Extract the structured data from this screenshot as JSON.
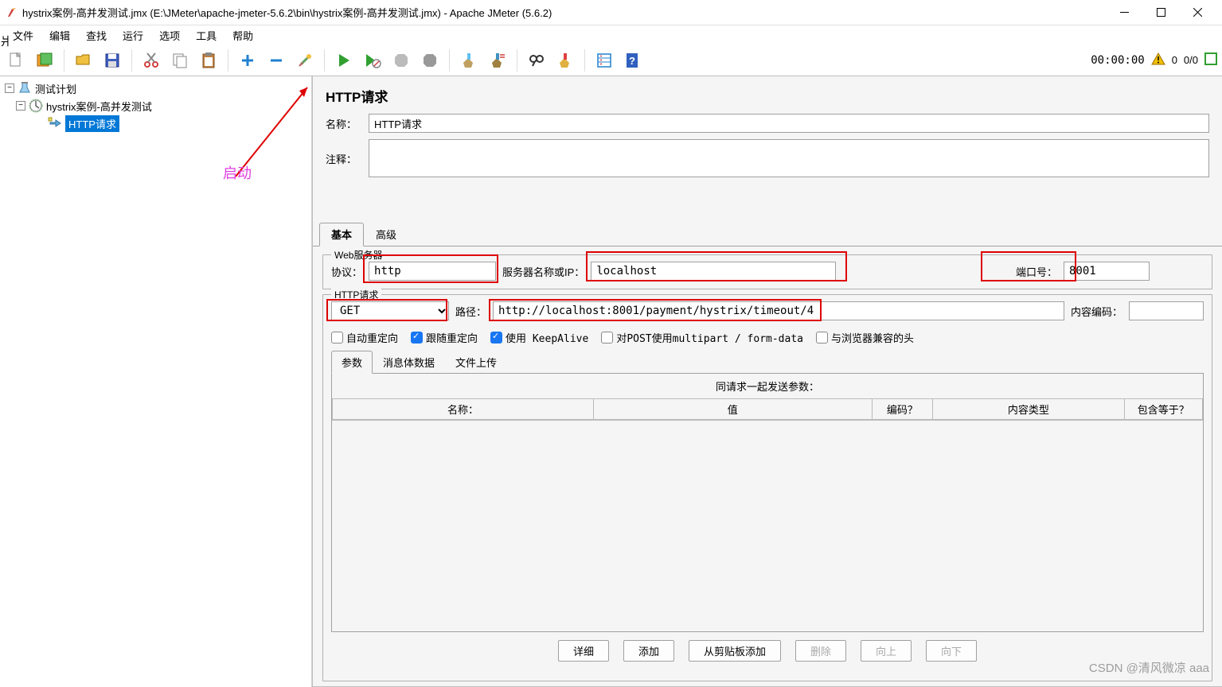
{
  "window": {
    "title": "hystrix案例-高并发测试.jmx (E:\\JMeter\\apache-jmeter-5.6.2\\bin\\hystrix案例-高并发测试.jmx) - Apache JMeter (5.6.2)"
  },
  "menu": {
    "file": "文件",
    "edit": "编辑",
    "search": "查找",
    "run": "运行",
    "options": "选项",
    "tools": "工具",
    "help": "帮助"
  },
  "toolbar": {
    "elapsed": "00:00:00",
    "warn_count": "0",
    "thread_count": "0/0"
  },
  "annotation": {
    "start": "启动"
  },
  "tree": {
    "root": "测试计划",
    "group": "hystrix案例-高并发测试",
    "http": "HTTP请求"
  },
  "panel": {
    "title": "HTTP请求",
    "name_label": "名称：",
    "name_value": "HTTP请求",
    "comment_label": "注释：",
    "comment_value": "",
    "tab_basic": "基本",
    "tab_advanced": "高级",
    "fs_web": "Web服务器",
    "protocol_label": "协议：",
    "protocol_value": "http",
    "server_label": "服务器名称或IP：",
    "server_value": "localhost",
    "port_label": "端口号：",
    "port_value": "8001",
    "fs_http": "HTTP请求",
    "method": "GET",
    "path_label": "路径：",
    "path_value": "http://localhost:8001/payment/hystrix/timeout/4",
    "enc_label": "内容编码：",
    "enc_value": "",
    "cb_autoredir": "自动重定向",
    "cb_followredir": "跟随重定向",
    "cb_keepalive": "使用 KeepAlive",
    "cb_multipart": "对POST使用multipart / form-data",
    "cb_browser": "与浏览器兼容的头",
    "itab_params": "参数",
    "itab_body": "消息体数据",
    "itab_files": "文件上传",
    "params_title": "同请求一起发送参数：",
    "col_name": "名称：",
    "col_value": "值",
    "col_encode": "编码？",
    "col_ctype": "内容类型",
    "col_include": "包含等于？",
    "btn_detail": "详细",
    "btn_add": "添加",
    "btn_clip": "从剪贴板添加",
    "btn_del": "删除",
    "btn_up": "向上",
    "btn_down": "向下"
  },
  "watermark": "CSDN @清风微凉 aaa"
}
